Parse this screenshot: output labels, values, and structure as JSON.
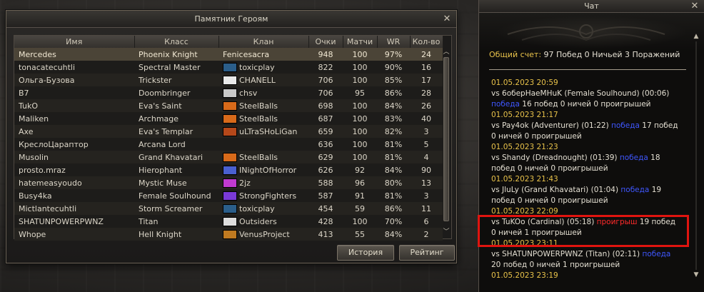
{
  "hero_window": {
    "title": "Памятник Героям",
    "close_symbol": "✕",
    "columns": [
      "Имя",
      "Класс",
      "Клан",
      "Очки",
      "Матчи",
      "WR",
      "Кол-во"
    ],
    "rows": [
      {
        "name": "Mercedes",
        "class": "Phoenix Knight",
        "clan": "Fenicesacra",
        "crest": "",
        "points": "948",
        "matches": "100",
        "wr": "97%",
        "count": "24",
        "selected": true
      },
      {
        "name": "tonacatecuhtli",
        "class": "Spectral Master",
        "clan": "toxicplay",
        "crest": "#2b5e8a",
        "points": "822",
        "matches": "100",
        "wr": "90%",
        "count": "16"
      },
      {
        "name": "Ольга-Бузова",
        "class": "Trickster",
        "clan": "CHANELL",
        "crest": "#e9e9e9",
        "points": "706",
        "matches": "100",
        "wr": "85%",
        "count": "17"
      },
      {
        "name": "B7",
        "class": "Doombringer",
        "clan": "chsv",
        "crest": "#c8c8c8",
        "points": "706",
        "matches": "95",
        "wr": "86%",
        "count": "28"
      },
      {
        "name": "TukO",
        "class": "Eva's Saint",
        "clan": "SteelBalls",
        "crest": "#d86a1a",
        "points": "698",
        "matches": "100",
        "wr": "84%",
        "count": "26"
      },
      {
        "name": "Maliken",
        "class": "Archmage",
        "clan": "SteelBalls",
        "crest": "#d86a1a",
        "points": "687",
        "matches": "100",
        "wr": "83%",
        "count": "40"
      },
      {
        "name": "Axe",
        "class": "Eva's Templar",
        "clan": "uLTraSHoLiGan",
        "crest": "#b5481a",
        "points": "659",
        "matches": "100",
        "wr": "82%",
        "count": "3"
      },
      {
        "name": "КреслоЦарaптор",
        "class": "Arcana Lord",
        "clan": "",
        "crest": "",
        "points": "636",
        "matches": "100",
        "wr": "81%",
        "count": "5"
      },
      {
        "name": "Musolin",
        "class": "Grand Khavatari",
        "clan": "SteelBalls",
        "crest": "#d86a1a",
        "points": "629",
        "matches": "100",
        "wr": "81%",
        "count": "4"
      },
      {
        "name": "prosto.mraz",
        "class": "Hierophant",
        "clan": "INightOfHorror",
        "crest": "#4a60d0",
        "points": "626",
        "matches": "92",
        "wr": "84%",
        "count": "90"
      },
      {
        "name": "hatemeasyoudo",
        "class": "Mystic Muse",
        "clan": "2jz",
        "crest": "#c03ad0",
        "points": "588",
        "matches": "96",
        "wr": "80%",
        "count": "13"
      },
      {
        "name": "Busy4ka",
        "class": "Female Soulhound",
        "clan": "StrongFighters",
        "crest": "#7a3ad8",
        "points": "587",
        "matches": "91",
        "wr": "81%",
        "count": "3"
      },
      {
        "name": "Mictlantecuhtli",
        "class": "Storm Screamer",
        "clan": "toxicplay",
        "crest": "#2b5e8a",
        "points": "454",
        "matches": "59",
        "wr": "86%",
        "count": "11"
      },
      {
        "name": "SHATUNPOWERPWNZ",
        "class": "Titan",
        "clan": "Outsiders",
        "crest": "#dddddd",
        "points": "428",
        "matches": "100",
        "wr": "70%",
        "count": "6"
      },
      {
        "name": "Whope",
        "class": "Hell Knight",
        "clan": "VenusProject",
        "crest": "#c07a20",
        "points": "413",
        "matches": "55",
        "wr": "84%",
        "count": "2"
      }
    ],
    "history_button": "История",
    "rating_button": "Рейтинг"
  },
  "chat_window": {
    "title": "Чат",
    "close_symbol": "✕",
    "score_label": "Общий счет:",
    "score_value": "97 Побед 0 Ничьей 3 Поражений",
    "entries": [
      {
        "date": "01.05.2023 20:59",
        "text": "vs 6оберНаеМНuK (Female Soulhound) (00:06)",
        "result": "победа",
        "result_type": "win",
        "tail": "16 побед 0 ничей 0 проигрышей"
      },
      {
        "date": "01.05.2023 21:17",
        "text": "vs Pay4ok (Adventurer) (01:22)",
        "result": "победа",
        "result_type": "win",
        "tail": "17 побед 0 ничей 0 проигрышей"
      },
      {
        "date": "01.05.2023 21:23",
        "text": "vs Shandy (Dreadnought) (01:39)",
        "result": "победа",
        "result_type": "win",
        "tail": "18 побед 0 ничей 0 проигрышей"
      },
      {
        "date": "01.05.2023 21:43",
        "text": "vs JluLy (Grand Khavatari) (01:04)",
        "result": "победа",
        "result_type": "win",
        "tail": "19 побед 0 ничей 0 проигрышей"
      },
      {
        "date": "01.05.2023 22:09",
        "text": "vs TuKOo (Cardinal) (05:18)",
        "result": "проигрыш",
        "result_type": "loss",
        "tail": "19 побед 0 ничей 1 проигрышей"
      },
      {
        "date": "01.05.2023 23:11",
        "text": "vs SHATUNPOWERPWNZ (Titan) (02:11)",
        "result": "победа",
        "result_type": "win",
        "tail": "20 побед 0 ничей 1 проигрышей"
      },
      {
        "date": "01.05.2023 23:19",
        "text": "",
        "result": "",
        "result_type": "win",
        "tail": ""
      }
    ],
    "scroll_up_symbol": "▲",
    "scroll_down_symbol": "▼"
  },
  "hero_scroll": {
    "up_symbol": "︿",
    "down_symbol": "﹀"
  }
}
